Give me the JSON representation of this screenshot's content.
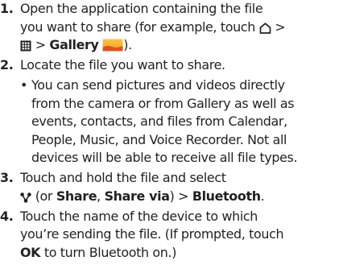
{
  "icons": {
    "home": "home-icon",
    "apps": "apps-grid-icon",
    "gallery": "gallery-icon",
    "share": "share-icon"
  },
  "colors": {
    "text": "#231f20",
    "gallery_icon_sky": "#f7a823",
    "gallery_icon_ground": "#d9541e"
  },
  "steps": [
    {
      "number": "1.",
      "line1": "Open the application containing the file",
      "line2_prefix": "you want to share (for example, touch",
      "line2_suffix": ">",
      "line3_sep": ">",
      "line3_bold": "Gallery",
      "line3_end": ")."
    },
    {
      "number": "2.",
      "line1": "Locate the file you want to share."
    },
    {
      "bullet": "•",
      "lines": [
        "You can send pictures and videos directly",
        "from the camera or from Gallery as well as",
        "events, contacts, and files from Calendar,",
        "People, Music, and Voice Recorder. Not all",
        "devices will be able to receive all file types."
      ]
    },
    {
      "number": "3.",
      "line1": "Touch and hold the file and select",
      "line2_open": "(or",
      "line2_bold1": "Share",
      "line2_comma": ",",
      "line2_bold2": "Share via",
      "line2_close": ") >",
      "line2_bold3": "Bluetooth",
      "line2_end": "."
    },
    {
      "number": "4.",
      "line1": "Touch the name of the device to which",
      "line2": "you’re sending the file. (If prompted, touch",
      "line3_bold": "OK",
      "line3_rest": "to turn Bluetooth on.)"
    }
  ]
}
